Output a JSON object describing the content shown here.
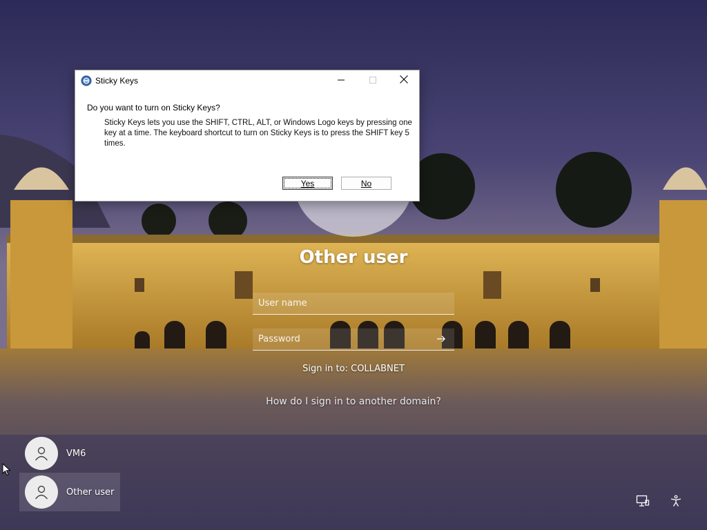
{
  "dialog": {
    "title": "Sticky Keys",
    "question": "Do you want to turn on Sticky Keys?",
    "message": "Sticky Keys lets you use the SHIFT, CTRL, ALT, or Windows Logo keys by pressing one key at a time. The keyboard shortcut to turn on Sticky Keys is to press the SHIFT key 5 times.",
    "yes_label": "Yes",
    "no_label": "No",
    "window_controls": [
      "minimize-icon",
      "maximize-icon",
      "close-icon"
    ]
  },
  "signin": {
    "user_title": "Other user",
    "username_placeholder": "User name",
    "password_placeholder": "Password",
    "sign_in_to": "Sign in to: COLLABNET",
    "domain_link": "How do I sign in to another domain?"
  },
  "users": [
    {
      "label": "VM6",
      "selected": false
    },
    {
      "label": "Other user",
      "selected": true
    }
  ],
  "system_icons": [
    "network-icon",
    "accessibility-icon"
  ],
  "colors": {
    "sky": "#3a3766",
    "palace": "#c99a32",
    "water": "#8a6a3a"
  }
}
